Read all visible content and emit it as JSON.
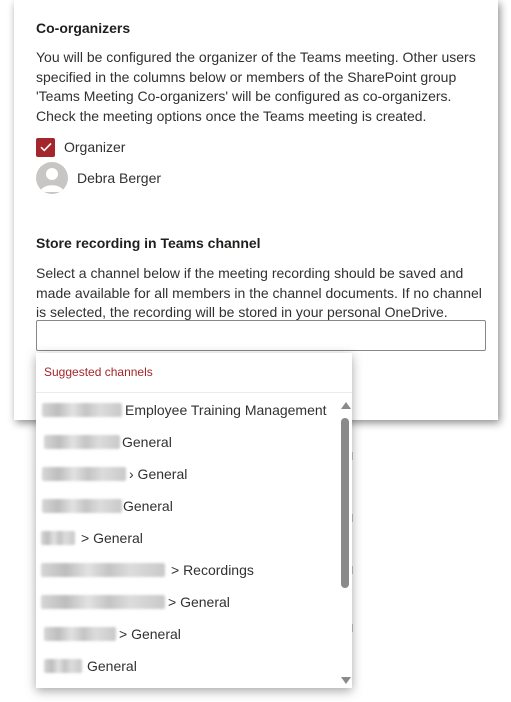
{
  "coorganizers": {
    "title": "Co-organizers",
    "description": "You will be configured the organizer of the Teams meeting. Other users specified in the columns below or members of the SharePoint group 'Teams Meeting Co-organizers' will be configured as co-organizers. Check the meeting options once the Teams meeting is created.",
    "organizer_checkbox": {
      "label": "Organizer",
      "checked": true,
      "color": "#a4262c"
    },
    "person": {
      "name": "Debra Berger",
      "icon": "person-icon"
    }
  },
  "recording": {
    "title": "Store recording in Teams channel",
    "description": "Select a channel below if the meeting recording should be saved and made available for all members in the channel documents. If no channel is selected, the recording will be stored in your personal OneDrive.",
    "input_value": ""
  },
  "dropdown": {
    "header": "Suggested channels",
    "options": [
      {
        "label": "Employee Training Management"
      },
      {
        "label": "General"
      },
      {
        "label": "› General"
      },
      {
        "label": "General"
      },
      {
        "label": "> General"
      },
      {
        "label": "> Recordings"
      },
      {
        "label": "> General"
      },
      {
        "label": "> General"
      },
      {
        "label": "General"
      }
    ]
  }
}
